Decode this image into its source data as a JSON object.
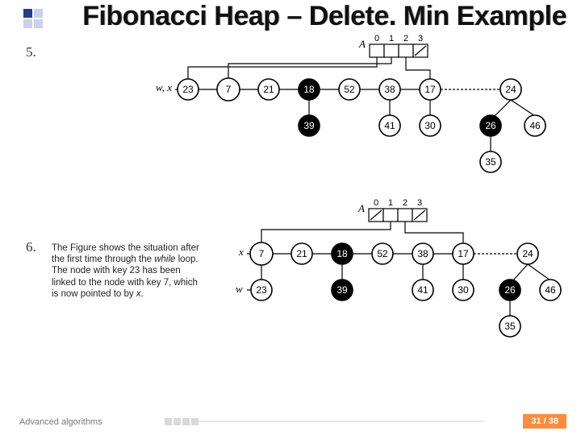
{
  "header": {
    "title": "Fibonacci Heap – Delete. Min Example"
  },
  "step5": {
    "num": "5."
  },
  "step6": {
    "num": "6.",
    "text_pre": "The Figure shows the situation after the first time through the ",
    "text_it1": "while",
    "text_mid": " loop. The node with key 23 has been linked to the node with key 7, which is now pointed to by ",
    "text_it2": "x",
    "text_post": "."
  },
  "fig5": {
    "array_label": "A",
    "indices": [
      "0",
      "1",
      "2",
      "3"
    ],
    "slash_slot": 3,
    "wx_label": "w, x",
    "roots": [
      {
        "v": "23",
        "fill": "w"
      },
      {
        "v": "7",
        "fill": "w"
      },
      {
        "v": "21",
        "fill": "w"
      },
      {
        "v": "18",
        "fill": "b"
      },
      {
        "v": "52",
        "fill": "w"
      },
      {
        "v": "38",
        "fill": "w"
      },
      {
        "v": "17",
        "fill": "w"
      },
      {
        "v": "24",
        "fill": "w"
      }
    ],
    "children": {
      "18": [
        {
          "v": "39",
          "fill": "b"
        }
      ],
      "38": [
        {
          "v": "41",
          "fill": "w"
        }
      ],
      "17": [
        {
          "v": "30",
          "fill": "w"
        }
      ],
      "24": [
        {
          "v": "26",
          "fill": "b"
        },
        {
          "v": "46",
          "fill": "w"
        }
      ],
      "26": [
        {
          "v": "35",
          "fill": "w"
        }
      ]
    }
  },
  "fig6": {
    "array_label": "A",
    "indices": [
      "0",
      "1",
      "2",
      "3"
    ],
    "slash_slots": [
      0,
      3
    ],
    "x_label": "x",
    "w_label": "w",
    "top_row": [
      {
        "v": "7",
        "fill": "w"
      },
      {
        "v": "21",
        "fill": "w"
      },
      {
        "v": "18",
        "fill": "b"
      },
      {
        "v": "52",
        "fill": "w"
      },
      {
        "v": "38",
        "fill": "w"
      },
      {
        "v": "17",
        "fill": "w"
      },
      {
        "v": "24",
        "fill": "w"
      }
    ],
    "children": {
      "7": [
        {
          "v": "23",
          "fill": "w"
        }
      ],
      "18": [
        {
          "v": "39",
          "fill": "b"
        }
      ],
      "38": [
        {
          "v": "41",
          "fill": "w"
        }
      ],
      "17": [
        {
          "v": "30",
          "fill": "w"
        }
      ],
      "24": [
        {
          "v": "26",
          "fill": "b"
        },
        {
          "v": "46",
          "fill": "w"
        }
      ],
      "26": [
        {
          "v": "35",
          "fill": "w"
        }
      ]
    }
  },
  "footer": {
    "label": "Advanced algorithms",
    "page": "31 / 38"
  }
}
